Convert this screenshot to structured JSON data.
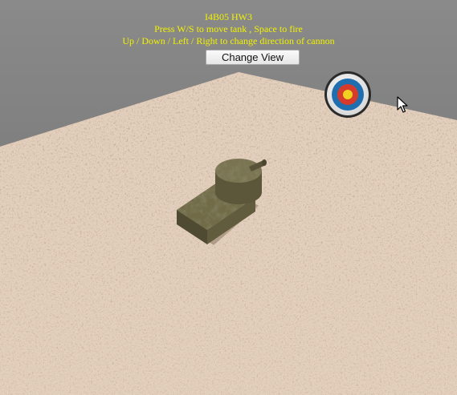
{
  "hud": {
    "title": "I4B05 HW3",
    "instructions_move": "Press W/S to move tank , Space to fire",
    "instructions_aim": "Up / Down / Left / Right to change direction of cannon",
    "change_view_label": "Change View"
  },
  "colors": {
    "hud_text": "#f2f200",
    "background": "#7a7a7a",
    "ground": "#c4a386",
    "tank": "#6f6a45",
    "target_outer": "#2a2a2a",
    "target_ring": "#1f6fb0",
    "target_red": "#d63a2a",
    "target_center": "#f0d020"
  },
  "scene": {
    "objects": [
      "sand-ground-plane",
      "tank",
      "tank-turret",
      "tank-cannon",
      "archery-target"
    ]
  }
}
